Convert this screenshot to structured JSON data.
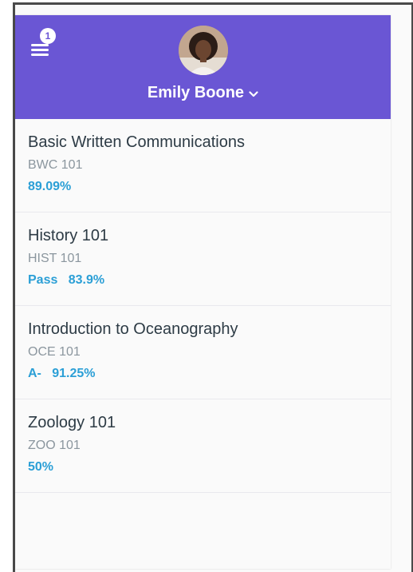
{
  "header": {
    "notification_count": "1",
    "user_name": "Emily Boone",
    "background_color": "#6a56d4"
  },
  "icons": {
    "menu": "hamburger-menu-icon",
    "chevron": "chevron-down-icon"
  },
  "courses": [
    {
      "name": "Basic Written Communications",
      "code": "BWC 101",
      "grade": "89.09%"
    },
    {
      "name": "History 101",
      "code": "HIST 101",
      "grade": "Pass   83.9%"
    },
    {
      "name": "Introduction to Oceanography",
      "code": "OCE 101",
      "grade": "A-   91.25%"
    },
    {
      "name": "Zoology 101",
      "code": "ZOO 101",
      "grade": "50%"
    }
  ],
  "colors": {
    "title_text": "#2d3b45",
    "code_text": "#8b969e",
    "grade_text": "#2b9fd6"
  }
}
